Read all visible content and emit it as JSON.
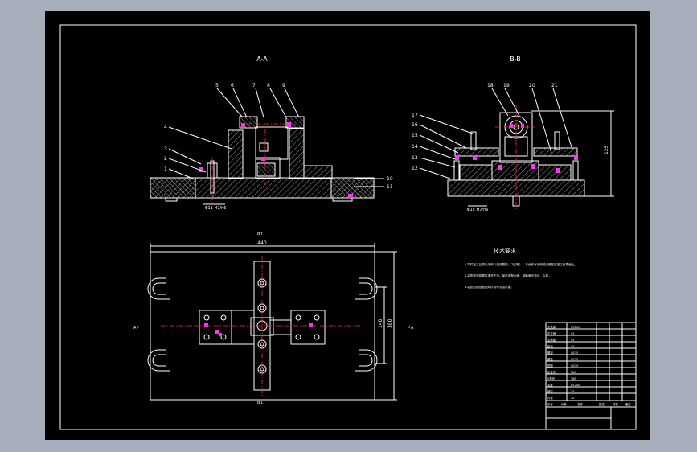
{
  "views": {
    "section_a": "A-A",
    "section_b": "B-B"
  },
  "callouts_a": [
    "5",
    "6",
    "7",
    "8",
    "9",
    "4",
    "3",
    "2",
    "1",
    "10",
    "11"
  ],
  "callouts_b": [
    "17",
    "16",
    "15",
    "14",
    "13",
    "12",
    "18",
    "19",
    "20",
    "21"
  ],
  "dims": {
    "width_top": "440",
    "height_inner": "140",
    "height_outer": "380",
    "height_b": "125",
    "fit_a": "Φ11 H7/h6",
    "fit_b": "Φ15 H7/h6"
  },
  "section_marks": {
    "b_top": "B↑",
    "b_bottom": "B↓",
    "a_left": "A└",
    "a_right": "┘A"
  },
  "notes": {
    "title": "技术要求",
    "items": [
      "1.零件加工后须去毛刺（包括翻边、飞边等），不允许有毛刺锐边残留在各工作表面上。",
      "2.装配前须将零件清洗干净，保证各配合面、接触面无油污、杂质。",
      "3.装配后检查各运动件动作灵活可靠。"
    ]
  },
  "title_block": {
    "left_rows": [
      "夹具体",
      "定位销",
      "支承板",
      "压板",
      "螺母",
      "螺栓",
      "垫圈",
      "定位块",
      "V形块",
      "支座",
      "销钉",
      "衬套"
    ],
    "mid_rows": [
      "HT200",
      "45",
      "45",
      "45",
      "Q235",
      "Q235",
      "Q235",
      "T8A",
      "T8A",
      "HT200",
      "35",
      "20"
    ],
    "footer": [
      "序号",
      "代号",
      "名称",
      "数量",
      "材料",
      "备注"
    ]
  },
  "colors": {
    "background": "#a7aebb",
    "paper": "#000000",
    "line": "#ffffff",
    "centerline": "#ff2a2a",
    "highlight": "#ff33ff"
  }
}
